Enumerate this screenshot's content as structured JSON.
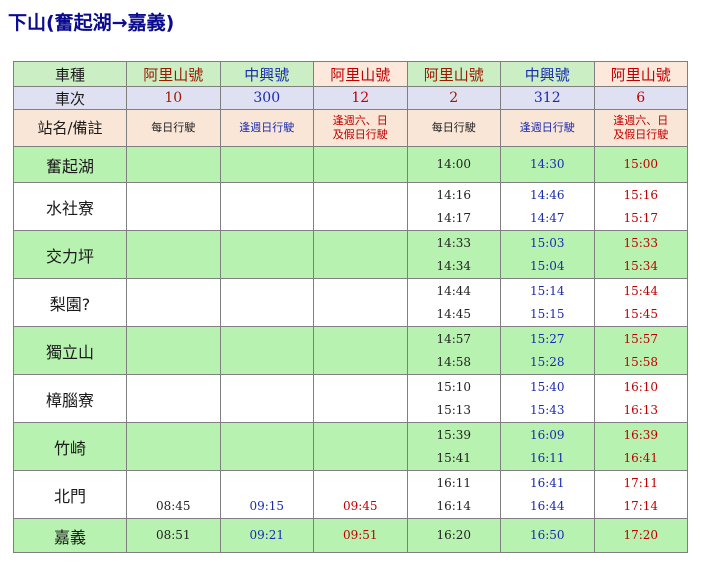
{
  "title": "下山(奮起湖→嘉義)",
  "colors": {
    "red": "#c00000",
    "blue": "#1222b8",
    "green_row": "#b8f2b0",
    "header_green": "#cbeec5",
    "trainno_blue": "#dfe1f3",
    "note_peach": "#f9e6d6"
  },
  "header": {
    "type_label": "車種",
    "number_label": "車次",
    "note_label": "站名/備註"
  },
  "trains": [
    {
      "type": "阿里山號",
      "number": "10",
      "note_line1": "每日行駛",
      "note_line2": ""
    },
    {
      "type": "中興號",
      "number": "300",
      "note_line1": "逢週日行駛",
      "note_line2": ""
    },
    {
      "type": "阿里山號",
      "number": "12",
      "note_line1": "逢週六、日",
      "note_line2": "及假日行駛"
    },
    {
      "type": "阿里山號",
      "number": "2",
      "note_line1": "每日行駛",
      "note_line2": ""
    },
    {
      "type": "中興號",
      "number": "312",
      "note_line1": "逢週日行駛",
      "note_line2": ""
    },
    {
      "type": "阿里山號",
      "number": "6",
      "note_line1": "逢週六、日",
      "note_line2": "及假日行駛"
    }
  ],
  "stations": [
    {
      "name": "奮起湖",
      "times": [
        [
          "",
          ""
        ],
        [
          "",
          ""
        ],
        [
          "",
          ""
        ],
        [
          "14:00",
          ""
        ],
        [
          "14:30",
          ""
        ],
        [
          "15:00",
          ""
        ]
      ]
    },
    {
      "name": "水社寮",
      "times": [
        [
          "",
          ""
        ],
        [
          "",
          ""
        ],
        [
          "",
          ""
        ],
        [
          "14:16",
          "14:17"
        ],
        [
          "14:46",
          "14:47"
        ],
        [
          "15:16",
          "15:17"
        ]
      ]
    },
    {
      "name": "交力坪",
      "times": [
        [
          "",
          ""
        ],
        [
          "",
          ""
        ],
        [
          "",
          ""
        ],
        [
          "14:33",
          "14:34"
        ],
        [
          "15:03",
          "15:04"
        ],
        [
          "15:33",
          "15:34"
        ]
      ]
    },
    {
      "name": "梨園?",
      "times": [
        [
          "",
          ""
        ],
        [
          "",
          ""
        ],
        [
          "",
          ""
        ],
        [
          "14:44",
          "14:45"
        ],
        [
          "15:14",
          "15:15"
        ],
        [
          "15:44",
          "15:45"
        ]
      ]
    },
    {
      "name": "獨立山",
      "times": [
        [
          "",
          ""
        ],
        [
          "",
          ""
        ],
        [
          "",
          ""
        ],
        [
          "14:57",
          "14:58"
        ],
        [
          "15:27",
          "15:28"
        ],
        [
          "15:57",
          "15:58"
        ]
      ]
    },
    {
      "name": "樟腦寮",
      "times": [
        [
          "",
          ""
        ],
        [
          "",
          ""
        ],
        [
          "",
          ""
        ],
        [
          "15:10",
          "15:13"
        ],
        [
          "15:40",
          "15:43"
        ],
        [
          "16:10",
          "16:13"
        ]
      ]
    },
    {
      "name": "竹崎",
      "times": [
        [
          "",
          ""
        ],
        [
          "",
          ""
        ],
        [
          "",
          ""
        ],
        [
          "15:39",
          "15:41"
        ],
        [
          "16:09",
          "16:11"
        ],
        [
          "16:39",
          "16:41"
        ]
      ]
    },
    {
      "name": "北門",
      "times": [
        [
          "",
          "08:45"
        ],
        [
          "",
          "09:15"
        ],
        [
          "",
          "09:45"
        ],
        [
          "16:11",
          "16:14"
        ],
        [
          "16:41",
          "16:44"
        ],
        [
          "17:11",
          "17:14"
        ]
      ]
    },
    {
      "name": "嘉義",
      "times": [
        [
          "08:51",
          ""
        ],
        [
          "09:21",
          ""
        ],
        [
          "09:51",
          ""
        ],
        [
          "16:20",
          ""
        ],
        [
          "16:50",
          ""
        ],
        [
          "17:20",
          ""
        ]
      ]
    }
  ]
}
